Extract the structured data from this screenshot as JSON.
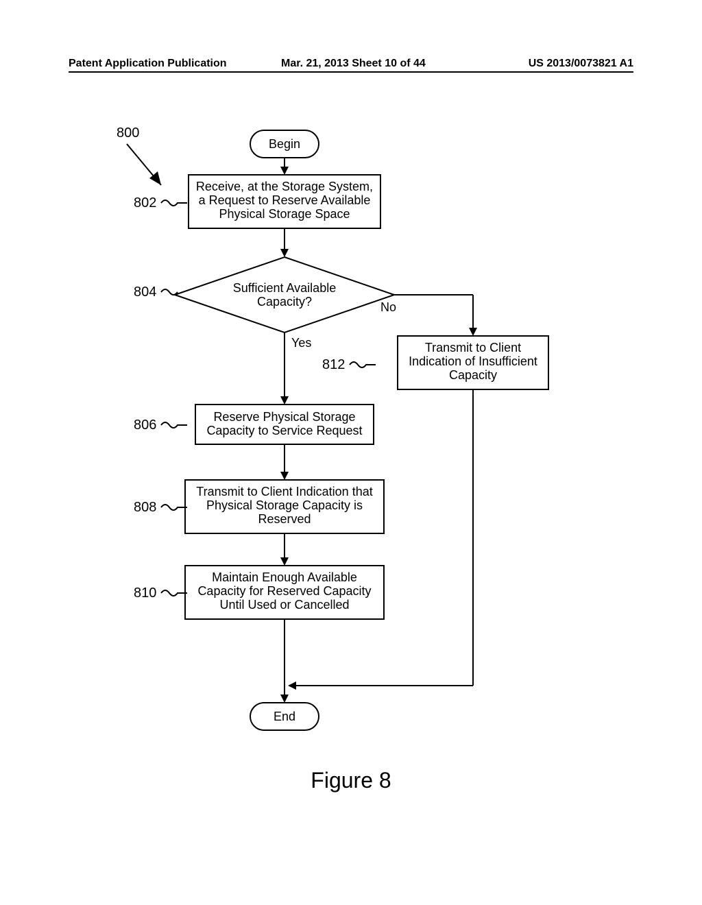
{
  "header": {
    "left": "Patent Application Publication",
    "center": "Mar. 21, 2013  Sheet 10 of 44",
    "right": "US 2013/0073821 A1"
  },
  "refs": {
    "r800": "800",
    "r802": "802",
    "r804": "804",
    "r806": "806",
    "r808": "808",
    "r810": "810",
    "r812": "812"
  },
  "nodes": {
    "begin": "Begin",
    "end": "End",
    "step802_l1": "Receive, at the Storage System,",
    "step802_l2": "a Request to Reserve Available",
    "step802_l3": "Physical Storage Space",
    "dec804_l1": "Sufficient Available",
    "dec804_l2": "Capacity?",
    "step806_l1": "Reserve Physical Storage",
    "step806_l2": "Capacity to Service Request",
    "step808_l1": "Transmit to Client Indication that",
    "step808_l2": "Physical Storage Capacity is",
    "step808_l3": "Reserved",
    "step810_l1": "Maintain Enough Available",
    "step810_l2": "Capacity for Reserved Capacity",
    "step810_l3": "Until Used or Cancelled",
    "step812_l1": "Transmit to Client",
    "step812_l2": "Indication of Insufficient",
    "step812_l3": "Capacity"
  },
  "branches": {
    "yes": "Yes",
    "no": "No"
  },
  "figure": "Figure 8"
}
